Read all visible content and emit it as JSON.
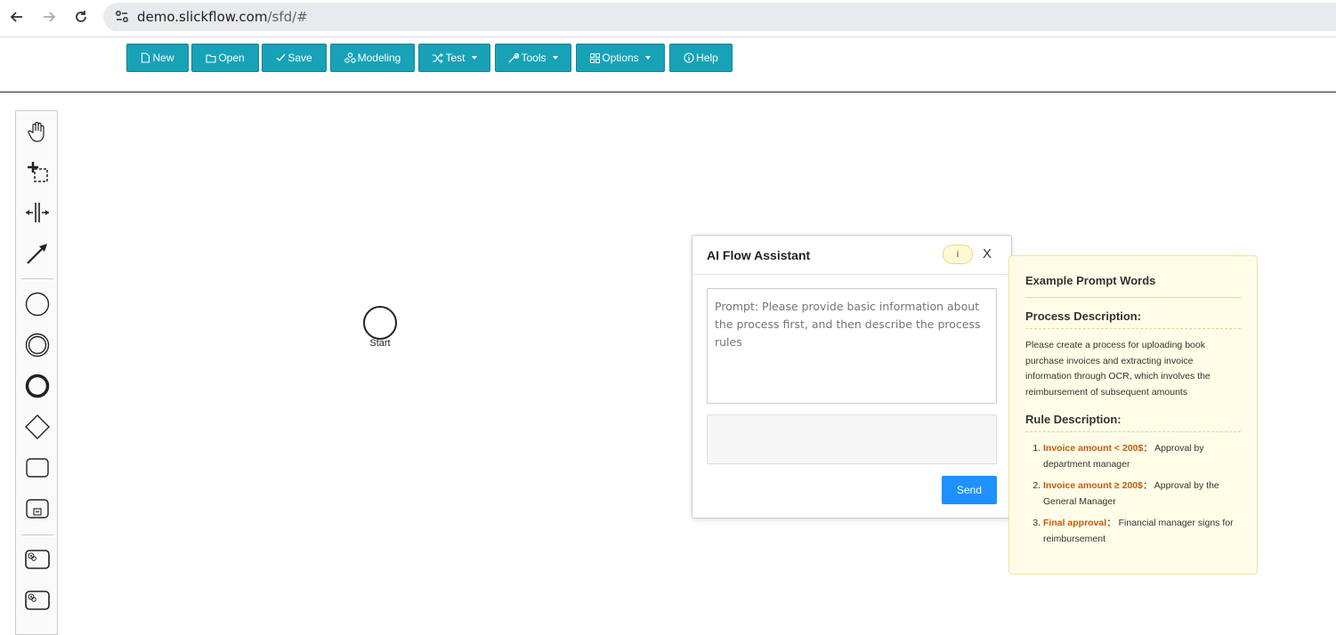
{
  "browser": {
    "url_host": "demo.slickflow.com",
    "url_path": "/sfd/#"
  },
  "toolbar": {
    "buttons": [
      {
        "label": "New",
        "icon": "file-icon"
      },
      {
        "label": "Open",
        "icon": "folder-icon"
      },
      {
        "label": "Save",
        "icon": "check-icon"
      },
      {
        "label": "Modeling",
        "icon": "modeling-icon"
      },
      {
        "label": "Test",
        "icon": "shuffle-icon"
      },
      {
        "label": "Tools",
        "icon": "wrench-icon"
      },
      {
        "label": "Options",
        "icon": "grid-icon"
      },
      {
        "label": "Help",
        "icon": "info-icon"
      }
    ],
    "color": "#17a2b8"
  },
  "palette": {
    "items": [
      "hand-tool-icon",
      "lasso-tool-icon",
      "space-tool-icon",
      "connect-tool-icon",
      "start-event-icon",
      "intermediate-event-icon",
      "end-event-icon",
      "gateway-icon",
      "task-icon",
      "subprocess-icon",
      "service-task-icon",
      "service-task-2-icon"
    ]
  },
  "canvas": {
    "start_label": "Start"
  },
  "ai_dialog": {
    "title": "AI Flow Assistant",
    "info_label": "i",
    "close_label": "X",
    "prompt_placeholder": "Prompt: Please provide basic information about the process first, and then describe the process rules",
    "send_label": "Send",
    "send_color": "#1e90ff"
  },
  "example": {
    "title": "Example Prompt Words",
    "process_heading": "Process Description:",
    "process_text": "Please create a process for uploading book purchase invoices and extracting invoice information through OCR, which involves the reimbursement of subsequent amounts",
    "rule_heading": "Rule Description:",
    "rules": [
      {
        "key": "Invoice amount < 200$",
        "sep": "：",
        "text": " Approval by department manager"
      },
      {
        "key": "Invoice amount ≥ 200$",
        "sep": "：",
        "text": " Approval by the General Manager"
      },
      {
        "key": "Final approval",
        "sep": "：",
        "text": " Financial manager signs for reimbursement"
      }
    ],
    "highlight_color": "#c75a0a"
  }
}
